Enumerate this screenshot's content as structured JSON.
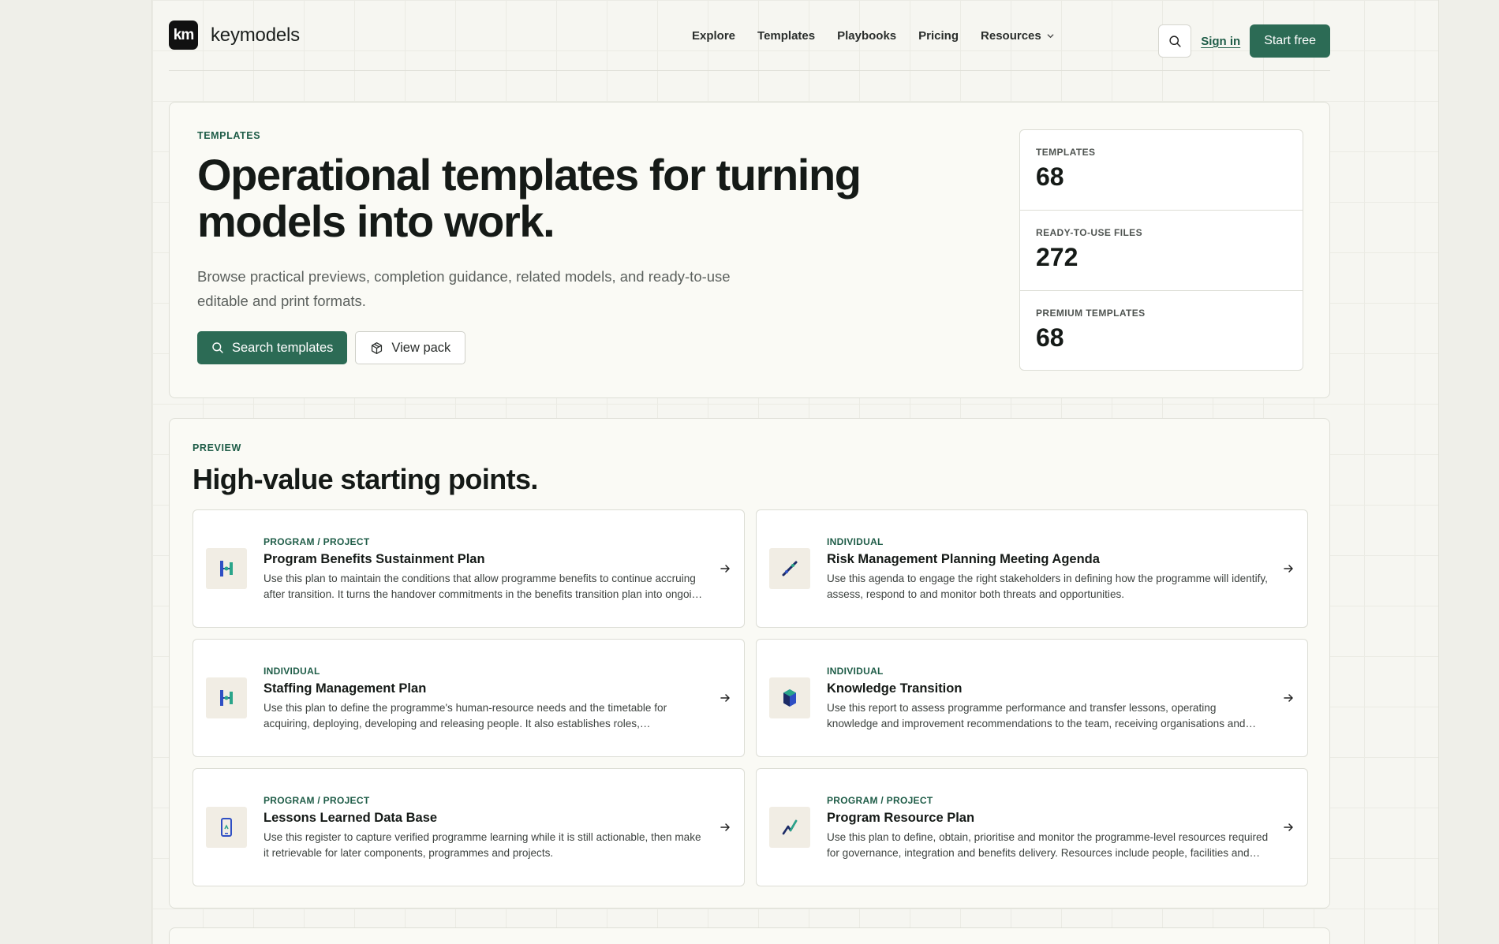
{
  "brand": {
    "mark": "km",
    "name": "keymodels"
  },
  "nav": {
    "items": [
      "Explore",
      "Templates",
      "Playbooks",
      "Pricing"
    ],
    "resources": "Resources",
    "sign_in": "Sign in",
    "start_free": "Start free"
  },
  "hero": {
    "eyebrow": "TEMPLATES",
    "title": "Operational templates for turning models into work.",
    "description": "Browse practical previews, completion guidance, related models, and ready-to-use editable and print formats.",
    "search_button": "Search templates",
    "pack_button": "View pack",
    "stats": [
      {
        "label": "TEMPLATES",
        "value": "68"
      },
      {
        "label": "READY-TO-USE FILES",
        "value": "272"
      },
      {
        "label": "PREMIUM TEMPLATES",
        "value": "68"
      }
    ]
  },
  "preview": {
    "eyebrow": "PREVIEW",
    "title": "High-value starting points.",
    "cards": [
      {
        "category": "PROGRAM / PROJECT",
        "title": "Program Benefits Sustainment Plan",
        "description": "Use this plan to maintain the conditions that allow programme benefits to continue accruing after transition. It turns the handover commitments in the benefits transition plan into ongoing measures.",
        "icon": "split-bars-icon"
      },
      {
        "category": "INDIVIDUAL",
        "title": "Risk Management Planning Meeting Agenda",
        "description": "Use this agenda to engage the right stakeholders in defining how the programme will identify, assess, respond to and monitor both threats and opportunities.",
        "icon": "diagonal-line-icon"
      },
      {
        "category": "INDIVIDUAL",
        "title": "Staffing Management Plan",
        "description": "Use this plan to define the programme's human-resource needs and the timetable for acquiring, deploying, developing and releasing people. It also establishes roles, responsibilities and reporting lines.",
        "icon": "split-bars-icon"
      },
      {
        "category": "INDIVIDUAL",
        "title": "Knowledge Transition",
        "description": "Use this report to assess programme performance and transfer lessons, operating knowledge and improvement recommendations to the team, receiving organisations and sponsors.",
        "icon": "hexagon-prism-icon"
      },
      {
        "category": "PROGRAM / PROJECT",
        "title": "Lessons Learned Data Base",
        "description": "Use this register to capture verified programme learning while it is still actionable, then make it retrievable for later components, programmes and projects.",
        "icon": "phone-device-icon"
      },
      {
        "category": "PROGRAM / PROJECT",
        "title": "Program Resource Plan",
        "description": "Use this plan to define, obtain, prioritise and monitor the programme-level resources required for governance, integration and benefits delivery. Resources include people, facilities and tools.",
        "icon": "zigzag-line-icon"
      }
    ]
  },
  "colors": {
    "accent": "#2c6b55",
    "accent_text": "#1e5c47",
    "background": "#f6f6f1"
  }
}
